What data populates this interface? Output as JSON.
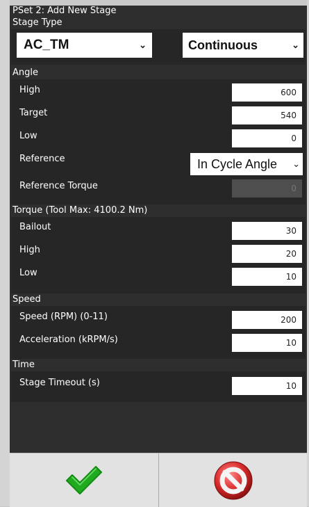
{
  "title": "PSet 2: Add New Stage",
  "stage_type": {
    "label": "Stage Type",
    "type_value": "AC_TM",
    "mode_value": "Continuous"
  },
  "angle": {
    "label": "Angle",
    "high_label": "High",
    "high_value": "600",
    "target_label": "Target",
    "target_value": "540",
    "low_label": "Low",
    "low_value": "0",
    "reference_label": "Reference",
    "reference_value": "In Cycle Angle",
    "reference_torque_label": "Reference Torque",
    "reference_torque_value": "0"
  },
  "torque": {
    "label": "Torque (Tool Max: 4100.2 Nm)",
    "bailout_label": "Bailout",
    "bailout_value": "30",
    "high_label": "High",
    "high_value": "20",
    "low_label": "Low",
    "low_value": "10"
  },
  "speed": {
    "label": "Speed",
    "rpm_label": "Speed (RPM) (0-11)",
    "rpm_value": "200",
    "accel_label": "Acceleration (kRPM/s)",
    "accel_value": "10"
  },
  "time": {
    "label": "Time",
    "timeout_label": "Stage Timeout (s)",
    "timeout_value": "10"
  },
  "icons": {
    "confirm": "checkmark-icon",
    "cancel": "cancel-icon",
    "accent_green": "#1faa1f",
    "accent_red": "#d92b2b"
  }
}
